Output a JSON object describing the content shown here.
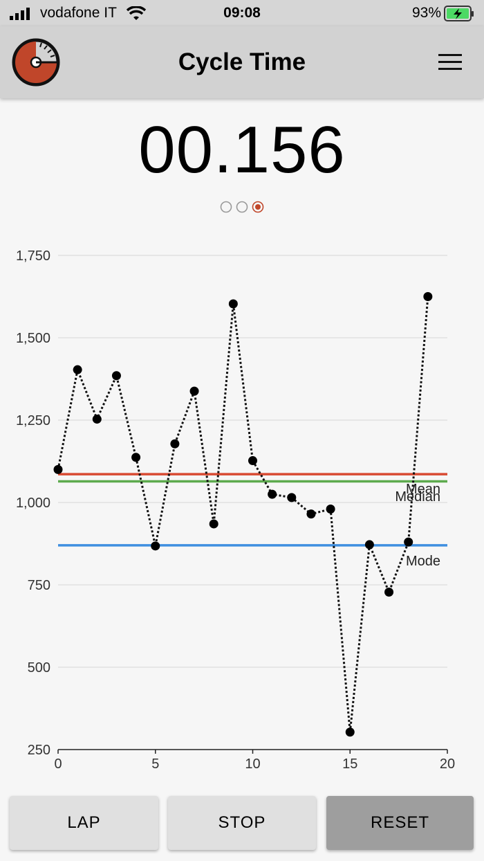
{
  "status_bar": {
    "carrier": "vodafone IT",
    "time": "09:08",
    "battery": "93%"
  },
  "app_bar": {
    "title": "Cycle Time"
  },
  "timer": {
    "value": "00.156"
  },
  "page_indicator": {
    "count": 3,
    "active": 2,
    "active_color": "#c0462a"
  },
  "chart_data": {
    "type": "line",
    "x": [
      0,
      1,
      2,
      3,
      4,
      5,
      6,
      7,
      8,
      9,
      10,
      11,
      12,
      13,
      14,
      15,
      16,
      17,
      18,
      19
    ],
    "series": [
      {
        "values": [
          1100,
          1403,
          1253,
          1385,
          1137,
          868,
          1178,
          1338,
          935,
          1603,
          1127,
          1025,
          1015,
          965,
          980,
          303,
          872,
          728,
          880,
          1625
        ]
      }
    ],
    "reference_lines": [
      {
        "name": "Mean",
        "value": 1086,
        "color": "#d84a32"
      },
      {
        "name": "Median",
        "value": 1064,
        "color": "#5daa4e"
      },
      {
        "name": "Mode",
        "value": 870,
        "color": "#3f8fe0"
      }
    ],
    "xlim": [
      0,
      20
    ],
    "ylim": [
      250,
      1750
    ],
    "x_ticks": [
      "0",
      "5",
      "10",
      "15",
      "20"
    ],
    "y_ticks": [
      "250",
      "500",
      "750",
      "1,000",
      "1,250",
      "1,500",
      "1,750"
    ],
    "grid": "horizontal"
  },
  "buttons": {
    "lap": "LAP",
    "stop": "STOP",
    "reset": "RESET"
  }
}
